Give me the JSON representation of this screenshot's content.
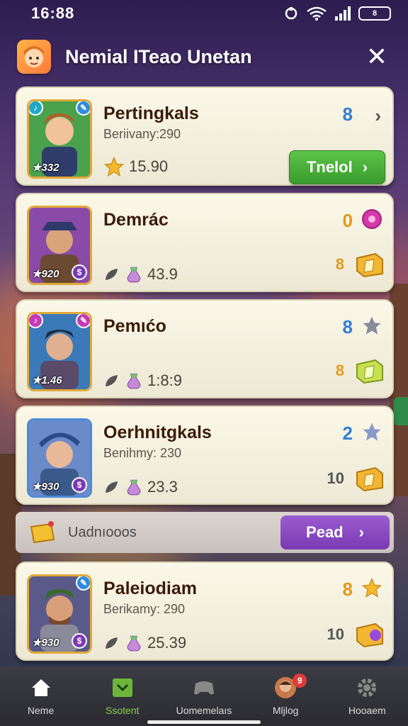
{
  "status_bar": {
    "time": "16:88",
    "battery": "8"
  },
  "header": {
    "title": "Nemial ITeao Unetan",
    "close_glyph": "✕"
  },
  "cards": [
    {
      "name": "Pertingkals",
      "subtitle": "Beriivany:290",
      "stat": "15.90",
      "level": "332",
      "rank": "8",
      "rank_color": "#2f7fd6",
      "button": "Tnelol"
    },
    {
      "name": "Demrác",
      "stat": "43.9",
      "level": "920",
      "rank": "0",
      "rank_color": "#e19a1a",
      "count": "8",
      "count_color": "#e19a1a"
    },
    {
      "name": "Pemıćo",
      "stat": "1:8:9",
      "level": "1.46",
      "rank": "8",
      "rank_color": "#2f7fd6",
      "count": "8",
      "count_color": "#e19a1a"
    },
    {
      "name": "Oerhnitgkals",
      "subtitle": "Benihmy: 230",
      "stat": "23.3",
      "level": "930",
      "rank": "2",
      "rank_color": "#2f7fd6",
      "count": "10",
      "count_color": "#555555"
    },
    {
      "name": "Paleiodiam",
      "subtitle": "Berikamy: 290",
      "stat": "25.39",
      "level": "930",
      "rank": "8",
      "rank_color": "#e19a1a",
      "count": "10",
      "count_color": "#555555"
    }
  ],
  "banner": {
    "text": "Uadnıooos",
    "button": "Pead"
  },
  "nav": [
    {
      "label": "Neme",
      "icon": "home-icon"
    },
    {
      "label": "Ssotent",
      "icon": "inbox-icon"
    },
    {
      "label": "Uomemelaıs",
      "icon": "gamepad-icon"
    },
    {
      "label": "Mljlog",
      "icon": "profile-icon",
      "badge": "9"
    },
    {
      "label": "Hooaem",
      "icon": "settings-icon"
    }
  ],
  "colors": {
    "accent_green": "#4db33a",
    "accent_purple": "#8a47c2",
    "gold": "#f2b632"
  }
}
